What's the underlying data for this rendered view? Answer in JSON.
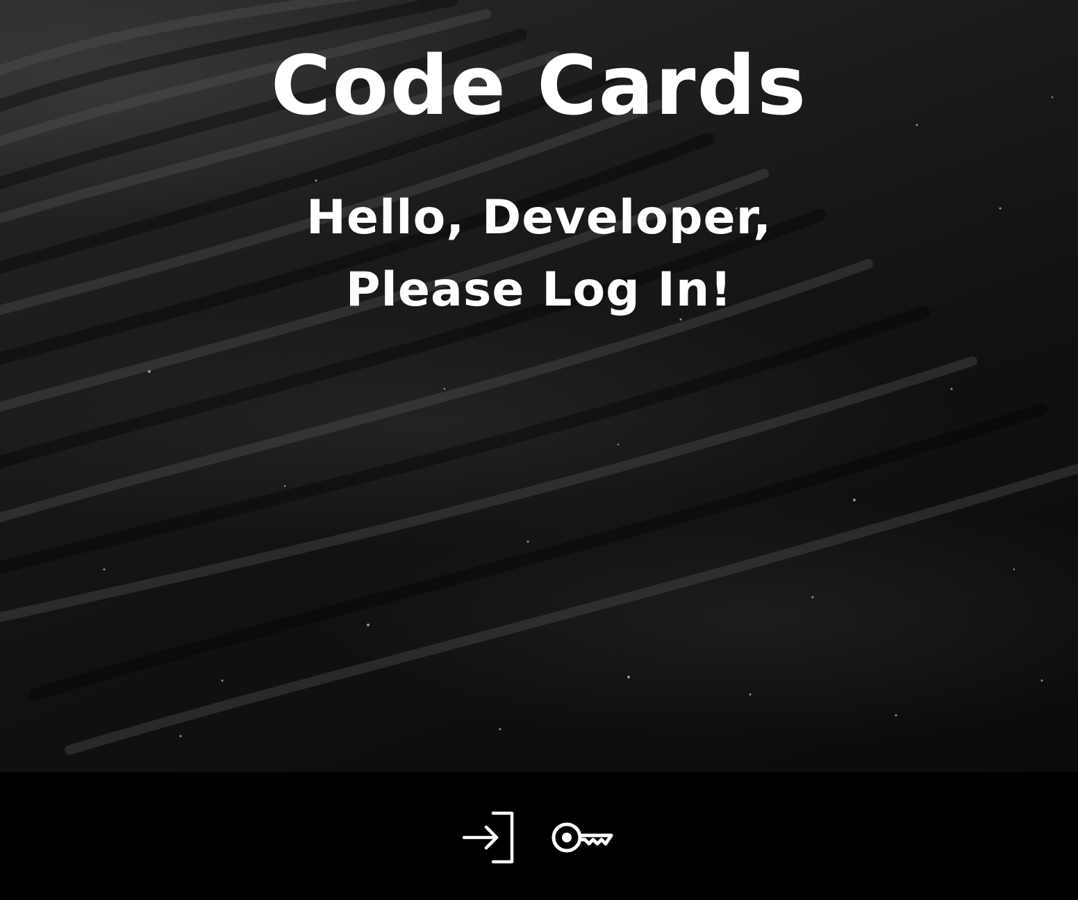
{
  "app": {
    "title": "Code Cards"
  },
  "greeting": {
    "line1": "Hello, Developer,",
    "line2": "Please Log In!"
  },
  "footer": {
    "icons": [
      "login-icon",
      "key-icon"
    ]
  },
  "colors": {
    "background": "#000000",
    "text": "#ffffff"
  }
}
